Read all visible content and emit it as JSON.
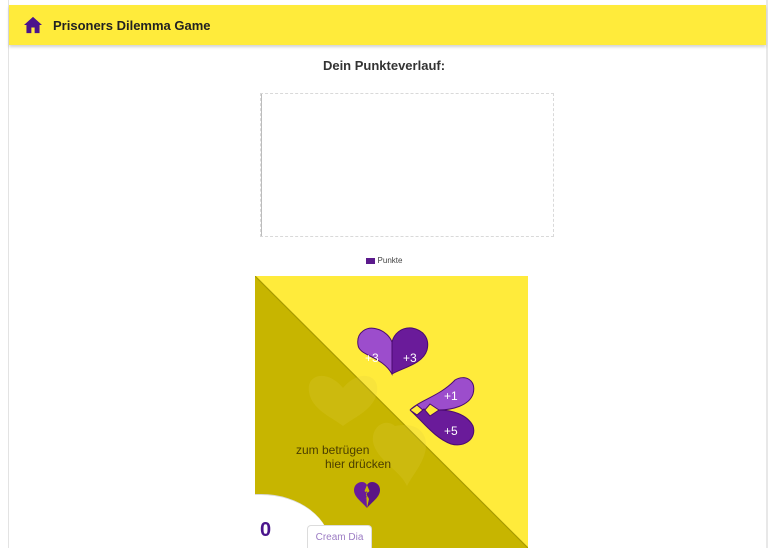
{
  "header": {
    "title": "Prisoners Dilemma Game",
    "home_icon": "home-icon"
  },
  "history": {
    "title": "Dein Punkteverlauf:",
    "legend_label": "Punkte",
    "legend_color": "#5b1a8c"
  },
  "card": {
    "cooperate_left": "+3",
    "cooperate_right": "+3",
    "betray_opponent": "+1",
    "betray_self": "+5",
    "betray_line1": "zum betrügen",
    "betray_line2": "hier drücken",
    "colors": {
      "yellow": "#ffeb3b",
      "dark_yellow": "#c7b500",
      "purple": "#6a1b9a",
      "light_purple": "#9c4dcc"
    }
  },
  "player": {
    "score": "0",
    "name": "Cream Dia"
  }
}
